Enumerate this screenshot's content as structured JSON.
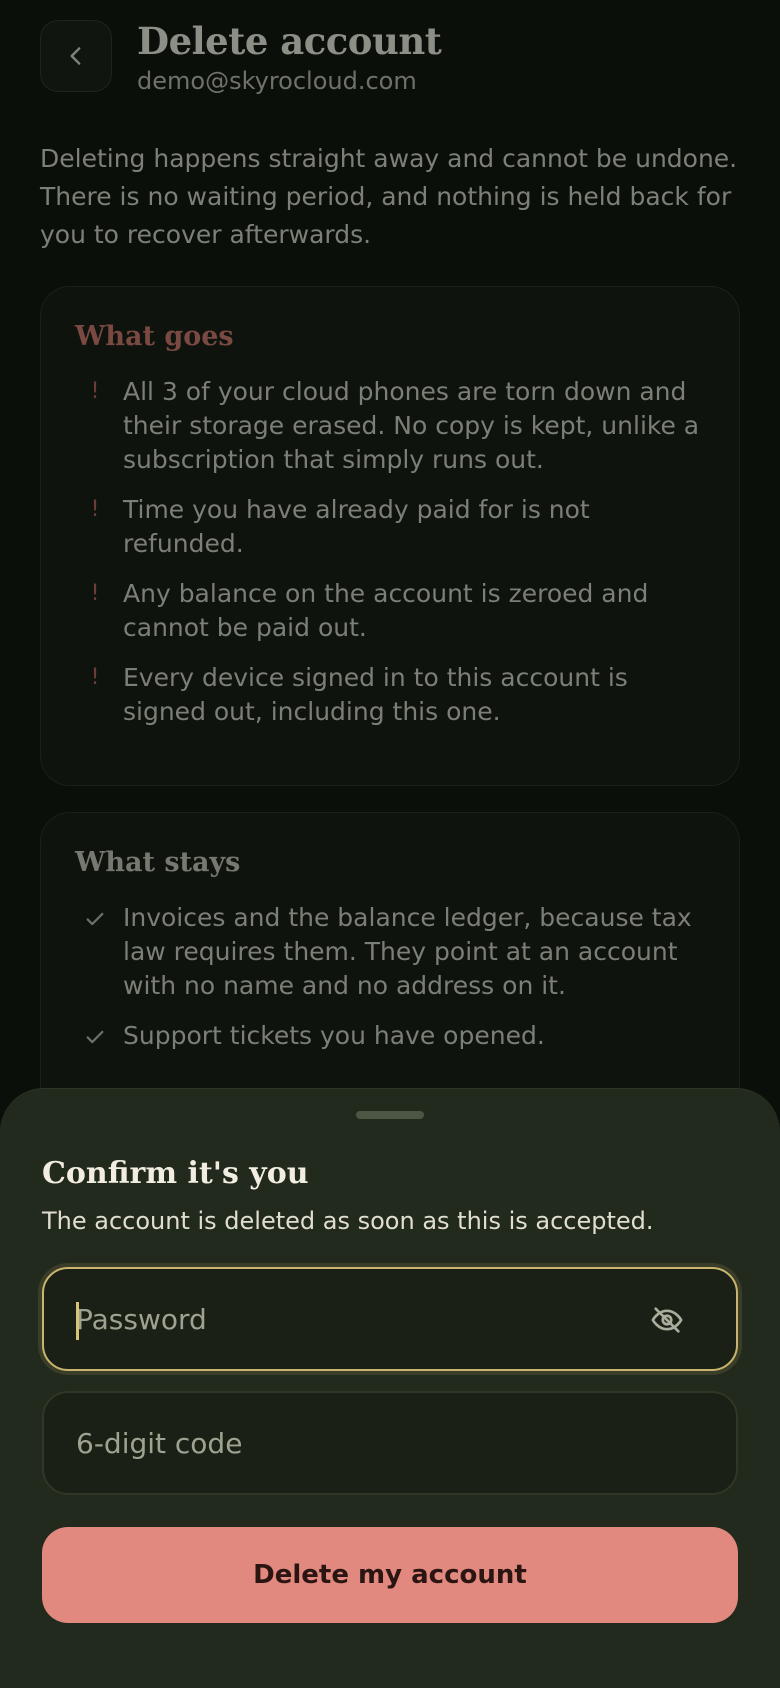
{
  "header": {
    "title": "Delete account",
    "email": "demo@skyrocloud.com",
    "back_icon": "chevron-left-icon"
  },
  "intro": "Deleting happens straight away and cannot be undone. There is no waiting period, and nothing is held back for you to recover afterwards.",
  "what_goes": {
    "title": "What goes",
    "items": [
      "All 3 of your cloud phones are torn down and their storage erased. No copy is kept, unlike a subscription that simply runs out.",
      "Time you have already paid for is not refunded.",
      "Any balance on the account is zeroed and cannot be paid out.",
      "Every device signed in to this account is signed out, including this one."
    ],
    "icon": "!"
  },
  "what_stays": {
    "title": "What stays",
    "items": [
      "Invoices and the balance ledger, because tax law requires them. They point at an account with no name and no address on it.",
      "Support tickets you have opened."
    ]
  },
  "sheet": {
    "title": "Confirm it's you",
    "subtitle": "The account is deleted as soon as this is accepted.",
    "password_placeholder": "Password",
    "code_placeholder": "6-digit code",
    "delete_label": "Delete my account",
    "eye_icon": "eye-off-icon"
  },
  "colors": {
    "accent_danger": "#e1897f",
    "focus_border": "#c9b56e",
    "sheet_bg": "#22291d"
  }
}
